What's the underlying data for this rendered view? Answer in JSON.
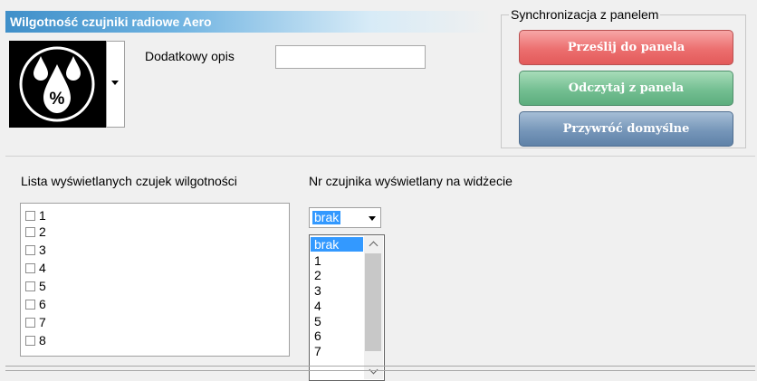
{
  "window": {
    "title": "Wilgotność czujniki radiowe Aero"
  },
  "icon": {
    "name": "humidity-drops-percent-icon",
    "glyph": "%"
  },
  "description": {
    "label": "Dodatkowy opis",
    "value": ""
  },
  "sync": {
    "title": "Synchronizacja z panelem",
    "send_label": "Prześlij do panela",
    "read_label": "Odczytaj z panela",
    "reset_label": "Przywróć domyślne",
    "colors": {
      "send": "#ec6f6f",
      "read": "#74bf92",
      "reset": "#7696b9"
    }
  },
  "sensors": {
    "list_label": "Lista wyświetlanych czujek wilgotności",
    "items": [
      {
        "label": "1",
        "checked": false
      },
      {
        "label": "2",
        "checked": false
      },
      {
        "label": "3",
        "checked": false
      },
      {
        "label": "4",
        "checked": false
      },
      {
        "label": "5",
        "checked": false
      },
      {
        "label": "6",
        "checked": false
      },
      {
        "label": "7",
        "checked": false
      },
      {
        "label": "8",
        "checked": false
      }
    ]
  },
  "widget_sensor": {
    "label": "Nr czujnika wyświetlany na widżecie",
    "selected": "brak",
    "options": [
      "brak",
      "1",
      "2",
      "3",
      "4",
      "5",
      "6",
      "7"
    ]
  }
}
